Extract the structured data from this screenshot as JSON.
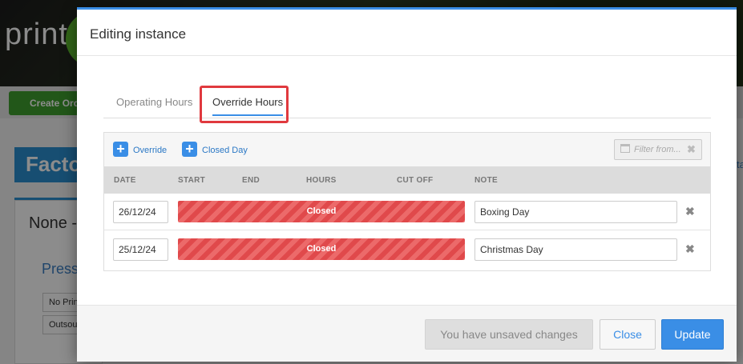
{
  "background": {
    "logo_text": "print",
    "create_order_label": "Create Orde",
    "page_title": "Facto",
    "section_title": "None -",
    "sub_title": "Press",
    "field1": "No Prin",
    "field2": "Outsou",
    "right_fragment": "ta"
  },
  "modal": {
    "title": "Editing instance",
    "tabs": [
      {
        "label": "Operating Hours",
        "active": false
      },
      {
        "label": "Override Hours",
        "active": true
      }
    ],
    "toolbar": {
      "add_override_label": "Override",
      "add_closed_day_label": "Closed Day",
      "filter_placeholder": "Filter from..."
    },
    "columns": [
      "DATE",
      "START",
      "END",
      "HOURS",
      "CUT OFF",
      "NOTE"
    ],
    "rows": [
      {
        "date": "26/12/24",
        "status": "Closed",
        "note": "Boxing Day"
      },
      {
        "date": "25/12/24",
        "status": "Closed",
        "note": "Christmas Day"
      }
    ],
    "footer": {
      "unsaved_label": "You have unsaved changes",
      "close_label": "Close",
      "update_label": "Update"
    }
  },
  "colors": {
    "accent": "#3a8ee6",
    "closed_stripe": "#e0494b",
    "highlight": "#e0393e",
    "brand_green": "#5cb82c"
  }
}
